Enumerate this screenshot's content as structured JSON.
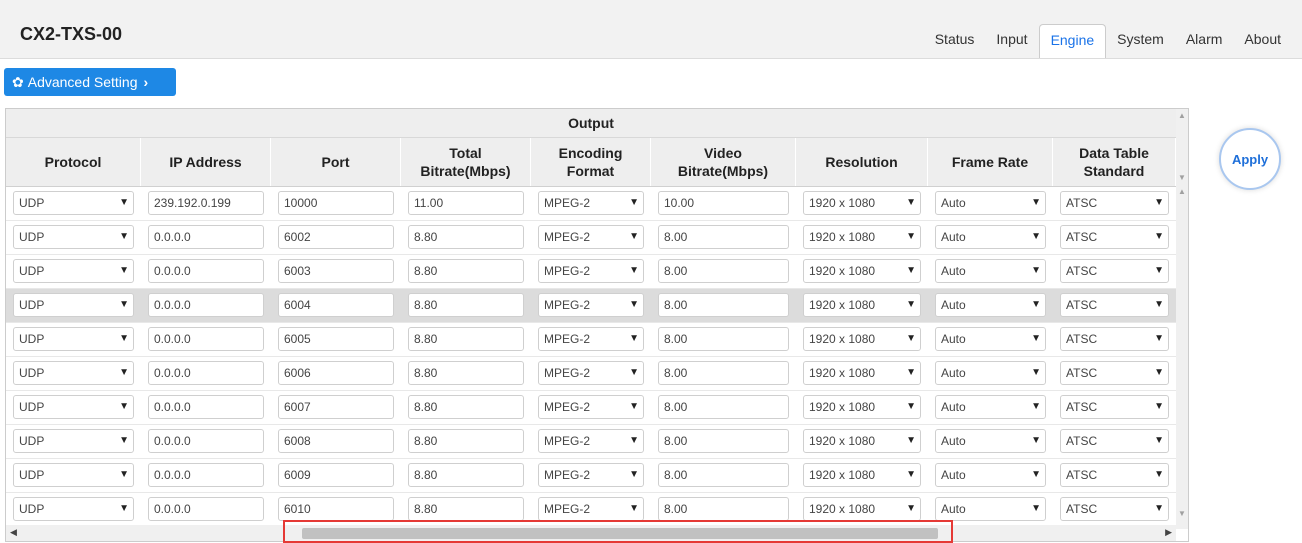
{
  "app": {
    "title": "CX2-TXS-00"
  },
  "nav": {
    "tabs": [
      {
        "label": "Status",
        "active": false
      },
      {
        "label": "Input",
        "active": false
      },
      {
        "label": "Engine",
        "active": true
      },
      {
        "label": "System",
        "active": false
      },
      {
        "label": "Alarm",
        "active": false
      },
      {
        "label": "About",
        "active": false
      }
    ]
  },
  "advanced": {
    "label": "Advanced Setting",
    "icon": "gear-icon"
  },
  "table": {
    "group_header": "Output",
    "columns": [
      {
        "line1": "Protocol",
        "line2": ""
      },
      {
        "line1": "IP Address",
        "line2": ""
      },
      {
        "line1": "Port",
        "line2": ""
      },
      {
        "line1": "Total",
        "line2": "Bitrate(Mbps)"
      },
      {
        "line1": "Encoding",
        "line2": "Format"
      },
      {
        "line1": "Video",
        "line2": "Bitrate(Mbps)"
      },
      {
        "line1": "Resolution",
        "line2": ""
      },
      {
        "line1": "Frame Rate",
        "line2": ""
      },
      {
        "line1": "Data Table",
        "line2": "Standard"
      }
    ],
    "rows": [
      {
        "protocol": "UDP",
        "ip": "239.192.0.199",
        "port": "10000",
        "total_bitrate": "11.00",
        "encoding": "MPEG-2",
        "video_bitrate": "10.00",
        "resolution": "1920 x 1080",
        "frame_rate": "Auto",
        "standard": "ATSC"
      },
      {
        "protocol": "UDP",
        "ip": "0.0.0.0",
        "port": "6002",
        "total_bitrate": "8.80",
        "encoding": "MPEG-2",
        "video_bitrate": "8.00",
        "resolution": "1920 x 1080",
        "frame_rate": "Auto",
        "standard": "ATSC"
      },
      {
        "protocol": "UDP",
        "ip": "0.0.0.0",
        "port": "6003",
        "total_bitrate": "8.80",
        "encoding": "MPEG-2",
        "video_bitrate": "8.00",
        "resolution": "1920 x 1080",
        "frame_rate": "Auto",
        "standard": "ATSC"
      },
      {
        "protocol": "UDP",
        "ip": "0.0.0.0",
        "port": "6004",
        "total_bitrate": "8.80",
        "encoding": "MPEG-2",
        "video_bitrate": "8.00",
        "resolution": "1920 x 1080",
        "frame_rate": "Auto",
        "standard": "ATSC"
      },
      {
        "protocol": "UDP",
        "ip": "0.0.0.0",
        "port": "6005",
        "total_bitrate": "8.80",
        "encoding": "MPEG-2",
        "video_bitrate": "8.00",
        "resolution": "1920 x 1080",
        "frame_rate": "Auto",
        "standard": "ATSC"
      },
      {
        "protocol": "UDP",
        "ip": "0.0.0.0",
        "port": "6006",
        "total_bitrate": "8.80",
        "encoding": "MPEG-2",
        "video_bitrate": "8.00",
        "resolution": "1920 x 1080",
        "frame_rate": "Auto",
        "standard": "ATSC"
      },
      {
        "protocol": "UDP",
        "ip": "0.0.0.0",
        "port": "6007",
        "total_bitrate": "8.80",
        "encoding": "MPEG-2",
        "video_bitrate": "8.00",
        "resolution": "1920 x 1080",
        "frame_rate": "Auto",
        "standard": "ATSC"
      },
      {
        "protocol": "UDP",
        "ip": "0.0.0.0",
        "port": "6008",
        "total_bitrate": "8.80",
        "encoding": "MPEG-2",
        "video_bitrate": "8.00",
        "resolution": "1920 x 1080",
        "frame_rate": "Auto",
        "standard": "ATSC"
      },
      {
        "protocol": "UDP",
        "ip": "0.0.0.0",
        "port": "6009",
        "total_bitrate": "8.80",
        "encoding": "MPEG-2",
        "video_bitrate": "8.00",
        "resolution": "1920 x 1080",
        "frame_rate": "Auto",
        "standard": "ATSC"
      },
      {
        "protocol": "UDP",
        "ip": "0.0.0.0",
        "port": "6010",
        "total_bitrate": "8.80",
        "encoding": "MPEG-2",
        "video_bitrate": "8.00",
        "resolution": "1920 x 1080",
        "frame_rate": "Auto",
        "standard": "ATSC"
      }
    ]
  },
  "apply": {
    "label": "Apply"
  },
  "colors": {
    "accent": "#1e88e5",
    "highlight_box": "#e53935"
  }
}
